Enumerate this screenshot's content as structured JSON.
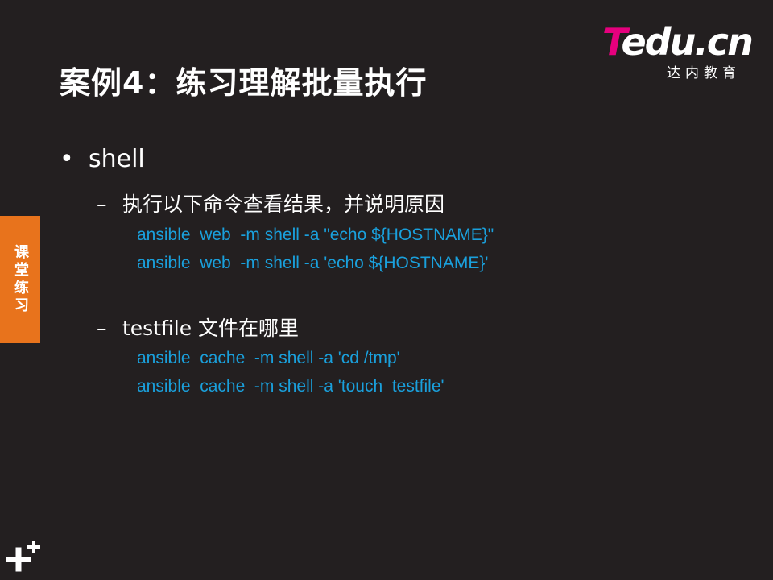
{
  "slide": {
    "title": "案例4：练习理解批量执行",
    "side_tab": "课堂练习"
  },
  "logo": {
    "brand_t": "T",
    "brand_rest": "edu.cn",
    "subtitle": "达内教育"
  },
  "content": {
    "bullet_symbol": "•",
    "dash_symbol": "–",
    "level1": "shell",
    "items": [
      {
        "heading": "执行以下命令查看结果，并说明原因",
        "lines": [
          "ansible  web  -m shell -a \"echo ${HOSTNAME}\"",
          "ansible  web  -m shell -a 'echo ${HOSTNAME}'"
        ]
      },
      {
        "heading": "testfile 文件在哪里",
        "lines": [
          "ansible  cache  -m shell -a 'cd /tmp'",
          "ansible  cache  -m shell -a 'touch  testfile'"
        ]
      }
    ]
  },
  "colors": {
    "background": "#231f20",
    "accent_orange": "#e8731c",
    "code_blue": "#1aa0dc",
    "brand_pink": "#e6007e"
  }
}
